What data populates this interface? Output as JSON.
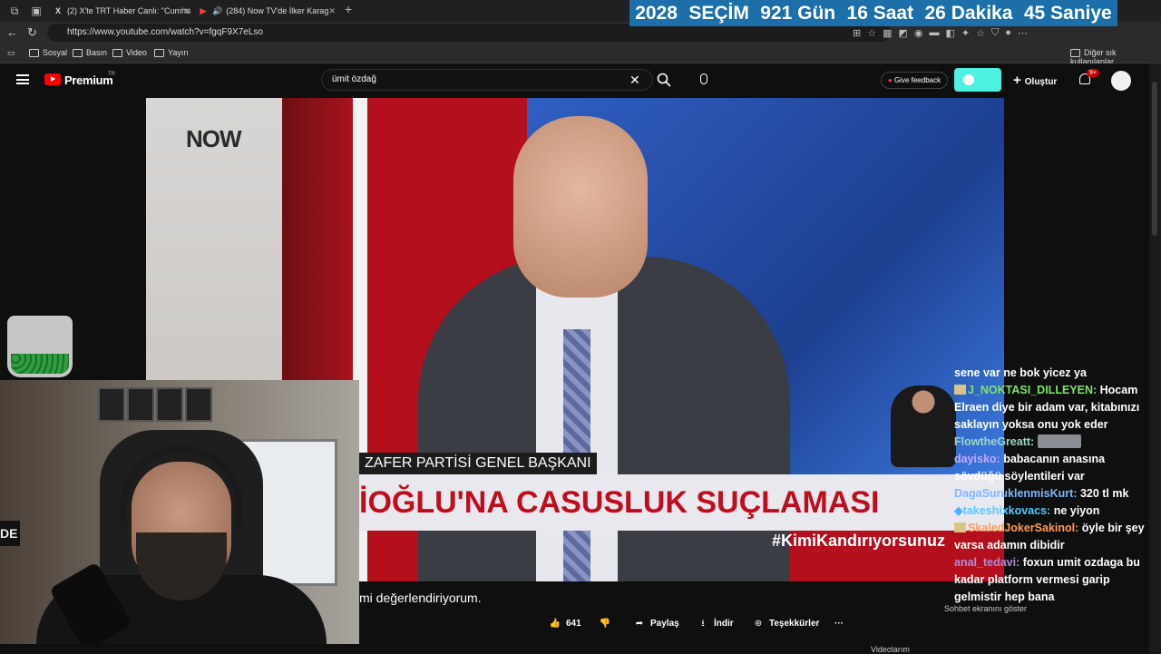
{
  "browser": {
    "tabs": [
      {
        "icon": "X",
        "title": "(2) X'te TRT Haber Canlı: \"Cumhu"
      },
      {
        "icon": "▶",
        "title": "(284) Now TV'de İlker Karag"
      }
    ],
    "url": "https://www.youtube.com/watch?v=fgqF9X7eLso",
    "bookmarks": [
      "Sosyal",
      "Basın",
      "Video",
      "Yayın"
    ],
    "bookmarks_other": "Diğer sık kullanılanlar"
  },
  "countdown": {
    "label_year": "2028",
    "label_event": "SEÇİM",
    "days": "921 Gün",
    "hours": "16 Saat",
    "minutes": "26 Dakika",
    "seconds": "45 Saniye"
  },
  "youtube": {
    "brand": "Premium",
    "region": "TR",
    "search_value": "ümit özdağ",
    "feedback_label": "Give feedback",
    "create_label": "Oluştur",
    "notifications": "9+"
  },
  "video": {
    "channel_logo": "NOW",
    "lower_title": "ZAFER PARTİSİ GENEL BAŞKANI",
    "headline": "İOĞLU'NA CASUSLUK SUÇLAMASI",
    "hashtag": "#KimiKandırıyorsunuz",
    "caption": "mi değerlendiriyorum.",
    "webcam_sign": "DE"
  },
  "actions": {
    "likes": "641",
    "share": "Paylaş",
    "download": "İndir",
    "thanks": "Teşekkürler",
    "more": "···"
  },
  "chat": [
    {
      "user": "",
      "text": "sene var ne bok yicez ya",
      "cls": "u2"
    },
    {
      "user": "J_NOKTASI_DILLEYEN:",
      "text": "Hocam Elraen diye bir adam var, kitabınızı saklayın yoksa onu yok eder",
      "cls": "u1",
      "badge": true
    },
    {
      "user": "FlowtheGreatt:",
      "text": "",
      "cls": "u2",
      "emote": true
    },
    {
      "user": "dayisko:",
      "text": "babacanın anasına sövdüğü söylentileri var",
      "cls": "u3"
    },
    {
      "user": "DagaSuruklenmisKurt:",
      "text": "320 tl mk",
      "cls": "u4"
    },
    {
      "user": "takeshixkovacs:",
      "text": "ne yiyon",
      "cls": "u5"
    },
    {
      "user": "SkaledJokerSakinol:",
      "text": "öyle bir şey varsa adamın dibidir",
      "cls": "u6",
      "badge": true
    },
    {
      "user": "anal_tedavi:",
      "text": "foxun umit ozdaga bu kadar platform vermesi garip gelmistir hep bana",
      "cls": "u7"
    }
  ],
  "chat_overlay": "Sohbet ekranını göster",
  "bottom_cut": "Videolarım"
}
